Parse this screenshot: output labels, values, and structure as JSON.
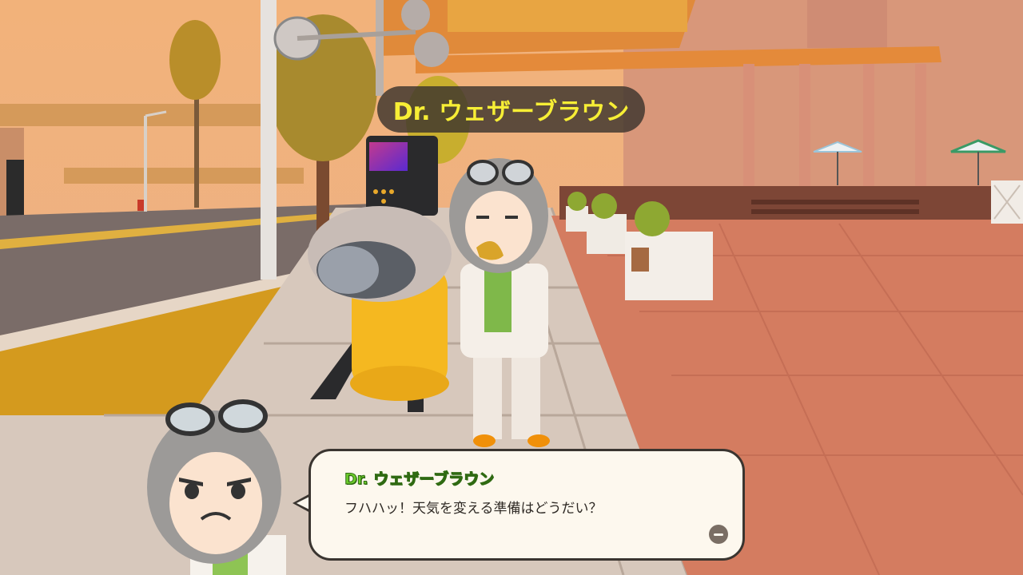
{
  "npc": {
    "name": "Dr. ウェザーブラウン"
  },
  "dialog": {
    "speaker": "Dr. ウェザーブラウン",
    "message": "フハハッ！天気を変える準備はどうだい？"
  },
  "icons": {
    "advance": "advance-dialog-icon",
    "portrait": "npc-portrait"
  },
  "colors": {
    "name_tag_text": "#f7ee35",
    "speaker_text": "#6ecf2c",
    "dialog_bg": "#fdf8ee"
  }
}
